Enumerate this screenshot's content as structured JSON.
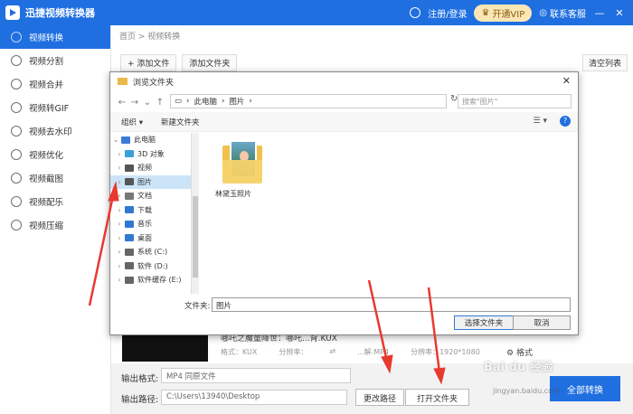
{
  "app": {
    "title": "迅捷视频转换器",
    "login": "注册/登录",
    "vip": "开通VIP",
    "service": "联系客服",
    "minimize": "—",
    "close": "✕"
  },
  "sidebar": {
    "items": [
      {
        "label": "视频转换"
      },
      {
        "label": "视频分割"
      },
      {
        "label": "视频合并"
      },
      {
        "label": "视频转GIF"
      },
      {
        "label": "视频去水印"
      },
      {
        "label": "视频优化"
      },
      {
        "label": "视频截图"
      },
      {
        "label": "视频配乐"
      },
      {
        "label": "视频压缩"
      }
    ]
  },
  "main": {
    "breadcrumb": "首页 > 视频转换",
    "add_file": "+ 添加文件",
    "add_folder": "添加文件夹",
    "clear_list": "清空列表",
    "file_name": "哪吒之魔童降世：哪吒...背.KUX",
    "file_format": "格式：KUX",
    "file_res": "分辨率：",
    "file_out": "...解.MP4",
    "file_res2": "分辨率：1920*1080",
    "settings": "格式",
    "output_format_label": "输出格式:",
    "output_format_value": "MP4  同原文件",
    "output_path_label": "输出路径:",
    "output_path_value": "C:\\Users\\13940\\Desktop",
    "change_path": "更改路径",
    "open_folder": "打开文件夹",
    "convert_all": "全部转换"
  },
  "dialog": {
    "title": "浏览文件夹",
    "close": "✕",
    "address": [
      "此电脑",
      "图片"
    ],
    "search_placeholder": "搜索\"图片\"",
    "organize": "组织 ▾",
    "new_folder": "新建文件夹",
    "help": "?",
    "tree": [
      {
        "label": "此电脑",
        "color": "#3a7bd5",
        "level": 0
      },
      {
        "label": "3D 对象",
        "color": "#3aa0d8",
        "level": 1
      },
      {
        "label": "视频",
        "color": "#555555",
        "level": 1
      },
      {
        "label": "图片",
        "color": "#555555",
        "level": 1,
        "selected": true
      },
      {
        "label": "文档",
        "color": "#777777",
        "level": 1
      },
      {
        "label": "下载",
        "color": "#2f7ad0",
        "level": 1
      },
      {
        "label": "音乐",
        "color": "#2f7ad0",
        "level": 1
      },
      {
        "label": "桌面",
        "color": "#2f7ad0",
        "level": 1
      },
      {
        "label": "系统 (C:)",
        "color": "#666666",
        "level": 1
      },
      {
        "label": "软件 (D:)",
        "color": "#666666",
        "level": 1
      },
      {
        "label": "软件缓存 (E:)",
        "color": "#666666",
        "level": 1
      }
    ],
    "folder_item": "林黛玉照片",
    "filename_label": "文件夹:",
    "filename_value": "图片",
    "select_button": "选择文件夹",
    "cancel_button": "取消"
  },
  "watermark": {
    "text": "Bai du 经验",
    "url": "jingyan.baidu.com"
  },
  "colors": {
    "accent": "#1f6fe0",
    "arrow": "#e8392f"
  }
}
